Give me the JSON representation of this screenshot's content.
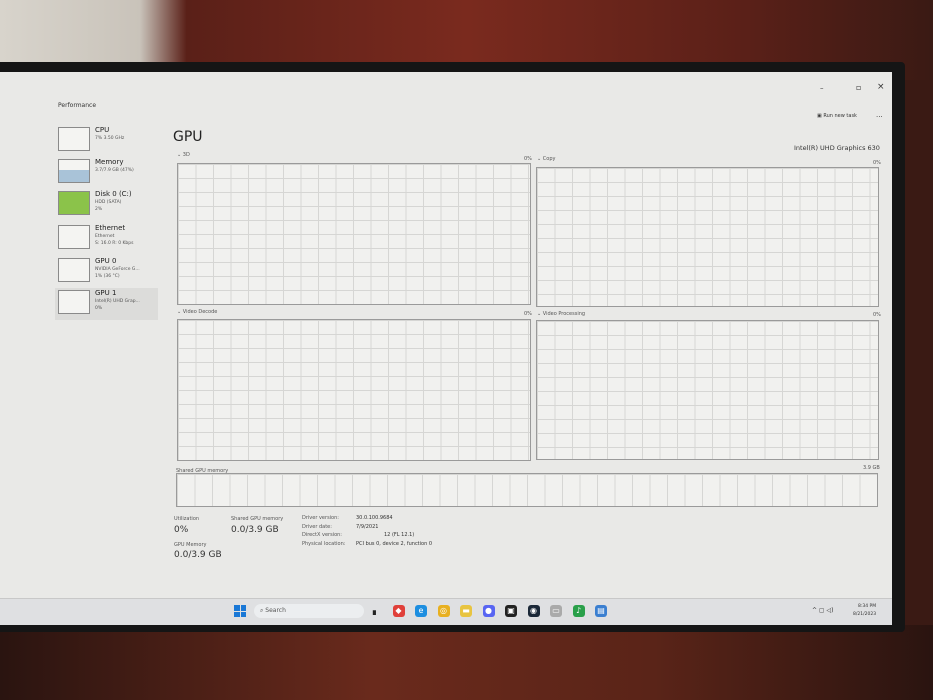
{
  "window": {
    "title": "Performance",
    "run_new_task": "Run new task",
    "more": "...",
    "minimize": "–",
    "maximize": "▫",
    "close": "×"
  },
  "sidebar": [
    {
      "name": "CPU",
      "sub1": "7% 3.50 GHz",
      "sub2": ""
    },
    {
      "name": "Memory",
      "sub1": "3.7/7.9 GB (47%)",
      "sub2": ""
    },
    {
      "name": "Disk 0 (C:)",
      "sub1": "HDD (SATA)",
      "sub2": "2%"
    },
    {
      "name": "Ethernet",
      "sub1": "Ethernet",
      "sub2": "S: 16.0 R: 0 Kbps"
    },
    {
      "name": "GPU 0",
      "sub1": "NVIDIA GeForce G...",
      "sub2": "1% (36 °C)"
    },
    {
      "name": "GPU 1",
      "sub1": "Intel(R) UHD Grap...",
      "sub2": "0%"
    }
  ],
  "main": {
    "title": "GPU",
    "device": "Intel(R) UHD Graphics 630",
    "graphs": [
      {
        "label": "3D",
        "pct": "0%"
      },
      {
        "label": "Copy",
        "pct": "0%"
      },
      {
        "label": "Video Decode",
        "pct": "0%"
      },
      {
        "label": "Video Processing",
        "pct": "0%"
      }
    ],
    "shared_label": "Shared GPU memory",
    "shared_max": "3.9 GB",
    "stats": {
      "util_label": "Utilization",
      "util": "0%",
      "shared_label": "Shared GPU memory",
      "shared": "0.0/3.9 GB",
      "gpumem_label": "GPU Memory",
      "gpumem": "0.0/3.9 GB"
    },
    "info": [
      [
        "Driver version:",
        "30.0.100.9684"
      ],
      [
        "Driver date:",
        "7/9/2021"
      ],
      [
        "DirectX version:",
        "12 (FL 12.1)"
      ],
      [
        "Physical location:",
        "PCI bus 0, device 2, function 0"
      ]
    ]
  },
  "taskbar": {
    "search": "Search",
    "time": "8:34 PM",
    "date": "8/21/2023",
    "apps": [
      "task-view",
      "brave",
      "edge",
      "chrome",
      "file-explorer",
      "discord",
      "epic-games",
      "steam",
      "app",
      "music",
      "task-manager"
    ]
  }
}
